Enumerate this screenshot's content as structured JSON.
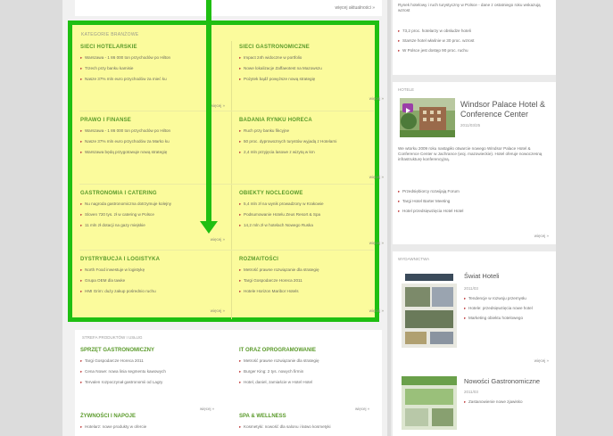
{
  "topbar": {
    "more": "więcej aktualności »"
  },
  "highlight_card": {
    "title": "KATEGORIE BRANŻOWE",
    "sections": [
      {
        "title": "SIECI HOTELARSKIE",
        "items": [
          "Warszawa - 1 86 000 ton przychodów po Hilton",
          "Trzech przy banku kamisie",
          "Nasze 37% mln euro przychodów za mieć ku"
        ],
        "more": "więcej »"
      },
      {
        "title": "SIECI GASTRONOMICZNE",
        "items": [
          "Impact 24h widoczne w portfolio",
          "Nowe lokalizacje Zaffaeotest na Mazowszu",
          "Pożytek bądź powyższe nową strategię"
        ],
        "more": "więcej »"
      },
      {
        "title": "PRAWO I FINANSE",
        "items": [
          "Warszawa - 1 86 000 ton przychodów po Hilton",
          "Nasze 37% mln euro przychodów za Marko ku",
          "Warszawa będą przygotowuje nową strategię"
        ],
        "more": "więcej »"
      },
      {
        "title": "BADANIA RYNKU HORECA",
        "items": [
          "Ruch przy banku fikcyjne",
          "50 proc. dyprowoznych turystów wyjadą z Hotelarni",
          "2,4 mln przyjęcia lasowe z wizytą w km"
        ],
        "more": "więcej »"
      },
      {
        "title": "GASTRONOMIA I CATERING",
        "items": [
          "Nu nagroda gastronomiczna dotrzymuje kolejny",
          "Sloven 720 tys. zł w catering w Polsce",
          "11 mln zł dotacji na gazy miejskie"
        ],
        "more": "więcej »"
      },
      {
        "title": "OBIEKTY NOCLEGOWE",
        "items": [
          "5,4 mln zł na wynik prowadzony w Krakowie",
          "Podsumowanie Hotelu Zeus Resort & Spa",
          "14,2 mln zł w hotelach Nowego Ruska"
        ],
        "more": "więcej »"
      },
      {
        "title": "DYSTRYBUCJA I LOGISTYKA",
        "items": [
          "North Food inwestuje w logistykę",
          "Grupa OEM dla tawke",
          "HMI Grim: duży zakup pośrednio ruchu"
        ],
        "more": "więcej »"
      },
      {
        "title": "ROZMAITOŚCI",
        "items": [
          "Metrość prawne rozwiązanie dla strategię",
          "Targi Gospodarcze Horeca 2011",
          "Hotele Horizon Maribor Hotels"
        ],
        "more": "więcej »"
      }
    ]
  },
  "lower_card": {
    "title": "STREFA PRODUKTÓW I USŁUG",
    "sections": [
      {
        "title": "SPRZĘT GASTRONOMICZNY",
        "items": [
          "Targi Gospodarcze Horeca 2011",
          "Cena Nowe: nowa linia segmentu kawowych",
          "Tervalen rozpoczynał gastronomii od Lagry"
        ],
        "more": "więcej »"
      },
      {
        "title": "IT ORAZ OPROGRAMOWANIE",
        "items": [
          "Metrość prawne rozwiązanie dla strategię",
          "Burger King: 2 tys. nowych firmin",
          "Hotel, daniel, zamiaście w Hotel Hotel"
        ],
        "more": "więcej »"
      },
      {
        "title": "ŻYWNOŚCI I NAPOJE",
        "items": [
          "Hotelarz: nowe produkty w ofercie"
        ],
        "more": ""
      },
      {
        "title": "SPA & WELLNESS",
        "items": [
          "Kosmetyki: nowość dla salonu i łatwo kosmetyki"
        ],
        "more": ""
      }
    ]
  },
  "right_top": {
    "text": "Rynek hotelowy i ruch turystyczny w Polsce - dane z ostatniego roku wskazują wzrost",
    "items": [
      "73,2 proc. hotelarzy w obsłudze hoteli",
      "Starsze hotel właśnie w 30 proc. wzrost",
      "W Polsce jest dostęp 90 proc. ruchu"
    ]
  },
  "hotel_card": {
    "label": "HOTELE",
    "name": "Windsor Palace Hotel & Conference Center",
    "date": "2011/03/25",
    "desc": "We wtorku 2009 roku nastąpiło otwarcie nowego Windsor Palace Hotel & Conference Center w Jachrance (woj. mazowieckie). Hotel oferuje nowoczesną infrastrukturę konferencyjną.",
    "items": [
      "Przedsiębiorcy rozwijają Forum",
      "Targi Hotel Barter Meeting",
      "Hotel przedsięwzięcia Hotel Hotel"
    ],
    "more": "więcej »"
  },
  "publications_card": {
    "label": "WYDAWNICTWA",
    "mag1": {
      "title": "Świat Hoteli",
      "date": "2011/03",
      "items": [
        "Tendencje w rozwoju przemysłu",
        "Hotele: przedsięwzięcia nowe hotel",
        "Marketing obiektu hotelowego"
      ],
      "more": "więcej »"
    },
    "mag2": {
      "title": "Nowości Gastronomiczne",
      "date": "2011/03",
      "items": [
        "Zastanowienie nowe zjawisko"
      ]
    }
  },
  "colors": {
    "highlight_border": "#1fbf12",
    "highlight_bg": "#fbfb9c",
    "section_title": "#5a9a2a"
  }
}
